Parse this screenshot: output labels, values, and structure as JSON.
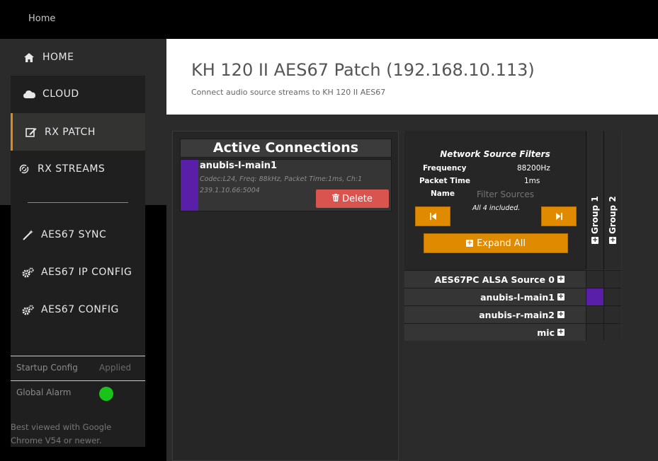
{
  "topbar": {
    "breadcrumb": "Home"
  },
  "sidebar": {
    "items": [
      {
        "label": "HOME",
        "icon": "home-icon"
      },
      {
        "label": "CLOUD",
        "icon": "cloud-icon"
      },
      {
        "label": "RX PATCH",
        "icon": "edit-icon"
      },
      {
        "label": "RX STREAMS",
        "icon": "streams-icon"
      },
      {
        "label": "AES67 SYNC",
        "icon": "wand-icon"
      },
      {
        "label": "AES67 IP CONFIG",
        "icon": "cogs-icon"
      },
      {
        "label": "AES67 CONFIG",
        "icon": "cogs-icon"
      }
    ],
    "startup_config_label": "Startup Config",
    "startup_config_value": "Applied",
    "global_alarm_label": "Global Alarm",
    "alarm_color": "#1ac31a",
    "note": "Best viewed with Google Chrome V54 or newer."
  },
  "header": {
    "title": "KH 120 II AES67 Patch (192.168.10.113)",
    "subtitle": "Connect audio source streams to KH 120 II AES67"
  },
  "active_connections": {
    "title": "Active Connections",
    "items": [
      {
        "name": "anubis-l-main1",
        "info": "Codec:L24, Freq: 88kHz, Packet Time:1ms, Ch:1",
        "address": "239.1.10.66:5004",
        "delete_label": "Delete",
        "color": "#5a1fa8"
      }
    ]
  },
  "filters": {
    "title": "Network Source Filters",
    "frequency_label": "Frequency",
    "frequency_value": "88200Hz",
    "packet_time_label": "Packet Time",
    "packet_time_value": "1ms",
    "name_label": "Name",
    "name_placeholder": "Filter Sources",
    "included_text": "All 4 included.",
    "expand_label": "Expand All"
  },
  "groups": [
    "Group 1",
    "Group 2"
  ],
  "sources": [
    {
      "name": "AES67PC ALSA Source 0",
      "connected_group": null
    },
    {
      "name": "anubis-l-main1",
      "connected_group": 1
    },
    {
      "name": "anubis-r-main2",
      "connected_group": null
    },
    {
      "name": "mic",
      "connected_group": null
    }
  ],
  "colors": {
    "accent": "#e08a00",
    "delete": "#d9534f",
    "connection": "#5a1fa8"
  }
}
